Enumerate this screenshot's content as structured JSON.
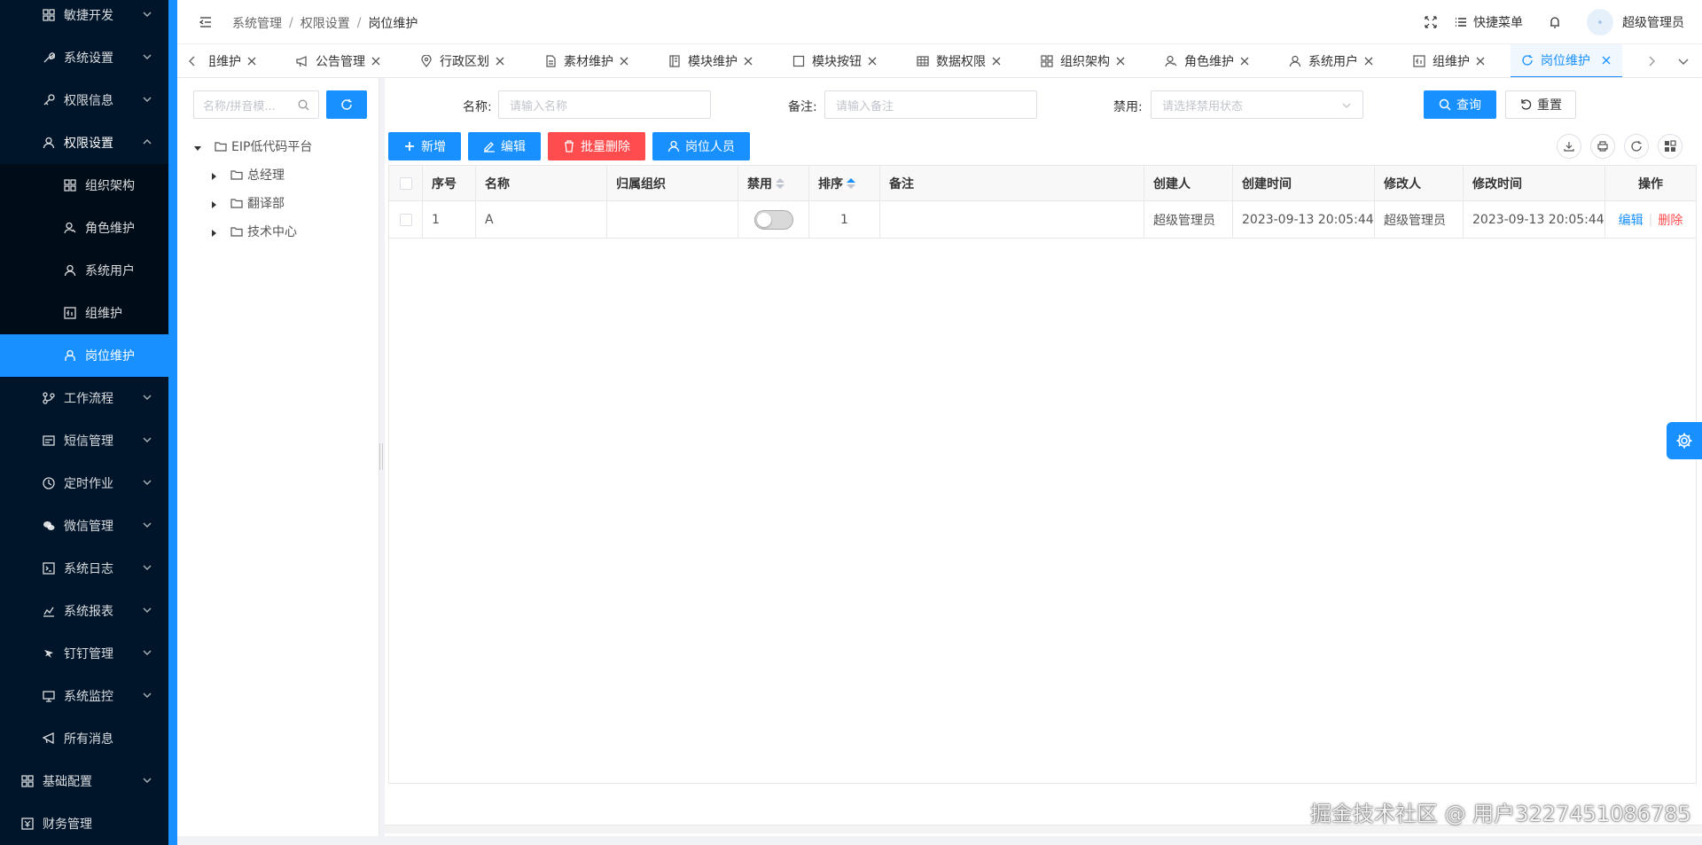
{
  "sidebar": {
    "items": [
      {
        "label": "敏捷开发",
        "icon": "grid-icon"
      },
      {
        "label": "系统设置",
        "icon": "wrench-icon"
      },
      {
        "label": "权限信息",
        "icon": "key-icon"
      },
      {
        "label": "权限设置",
        "icon": "user-icon"
      },
      {
        "label": "组织架构",
        "icon": "grid-icon"
      },
      {
        "label": "角色维护",
        "icon": "role-icon"
      },
      {
        "label": "系统用户",
        "icon": "user-icon"
      },
      {
        "label": "组维护",
        "icon": "group-icon"
      },
      {
        "label": "岗位维护",
        "icon": "post-icon"
      },
      {
        "label": "工作流程",
        "icon": "flow-icon"
      },
      {
        "label": "短信管理",
        "icon": "sms-icon"
      },
      {
        "label": "定时作业",
        "icon": "clock-icon"
      },
      {
        "label": "微信管理",
        "icon": "wechat-icon"
      },
      {
        "label": "系统日志",
        "icon": "log-icon"
      },
      {
        "label": "系统报表",
        "icon": "chart-icon"
      },
      {
        "label": "钉钉管理",
        "icon": "dingtalk-icon"
      },
      {
        "label": "系统监控",
        "icon": "monitor-icon"
      },
      {
        "label": "所有消息",
        "icon": "message-icon"
      },
      {
        "label": "基础配置",
        "icon": "grid-icon"
      },
      {
        "label": "财务管理",
        "icon": "finance-icon"
      }
    ]
  },
  "header": {
    "breadcrumb": [
      "系统管理",
      "权限设置",
      "岗位维护"
    ],
    "quick_menu": "快捷菜单",
    "user_name": "超级管理员"
  },
  "tabs": [
    {
      "label": "组维护"
    },
    {
      "label": "公告管理"
    },
    {
      "label": "行政区划"
    },
    {
      "label": "素材维护"
    },
    {
      "label": "模块维护"
    },
    {
      "label": "模块按钮"
    },
    {
      "label": "数据权限"
    },
    {
      "label": "组织架构"
    },
    {
      "label": "角色维护"
    },
    {
      "label": "系统用户"
    },
    {
      "label": "组维护"
    },
    {
      "label": "岗位维护"
    }
  ],
  "tree": {
    "search_placeholder": "名称/拼音模...",
    "root": "EIP低代码平台",
    "children": [
      "总经理",
      "翻译部",
      "技术中心"
    ]
  },
  "filters": {
    "name_label": "名称:",
    "name_placeholder": "请输入名称",
    "remark_label": "备注:",
    "remark_placeholder": "请输入备注",
    "disabled_label": "禁用:",
    "disabled_placeholder": "请选择禁用状态",
    "query": "查询",
    "reset": "重置"
  },
  "toolbar": {
    "add": "新增",
    "edit": "编辑",
    "batch_delete": "批量删除",
    "post_members": "岗位人员"
  },
  "table": {
    "columns": [
      "序号",
      "名称",
      "归属组织",
      "禁用",
      "排序",
      "备注",
      "创建人",
      "创建时间",
      "修改人",
      "修改时间",
      "操作"
    ],
    "rows": [
      {
        "index": "1",
        "name": "A",
        "org": "",
        "disabled": false,
        "sort": "1",
        "remark": "",
        "creator": "超级管理员",
        "created": "2023-09-13 20:05:44",
        "modifier": "超级管理员",
        "modified": "2023-09-13 20:05:44",
        "edit": "编辑",
        "delete": "删除"
      }
    ]
  },
  "watermark": "掘金技术社区 @ 用户3227451086785",
  "colors": {
    "primary": "#1890ff",
    "danger": "#ff4d4f",
    "sidebar": "#001529"
  }
}
